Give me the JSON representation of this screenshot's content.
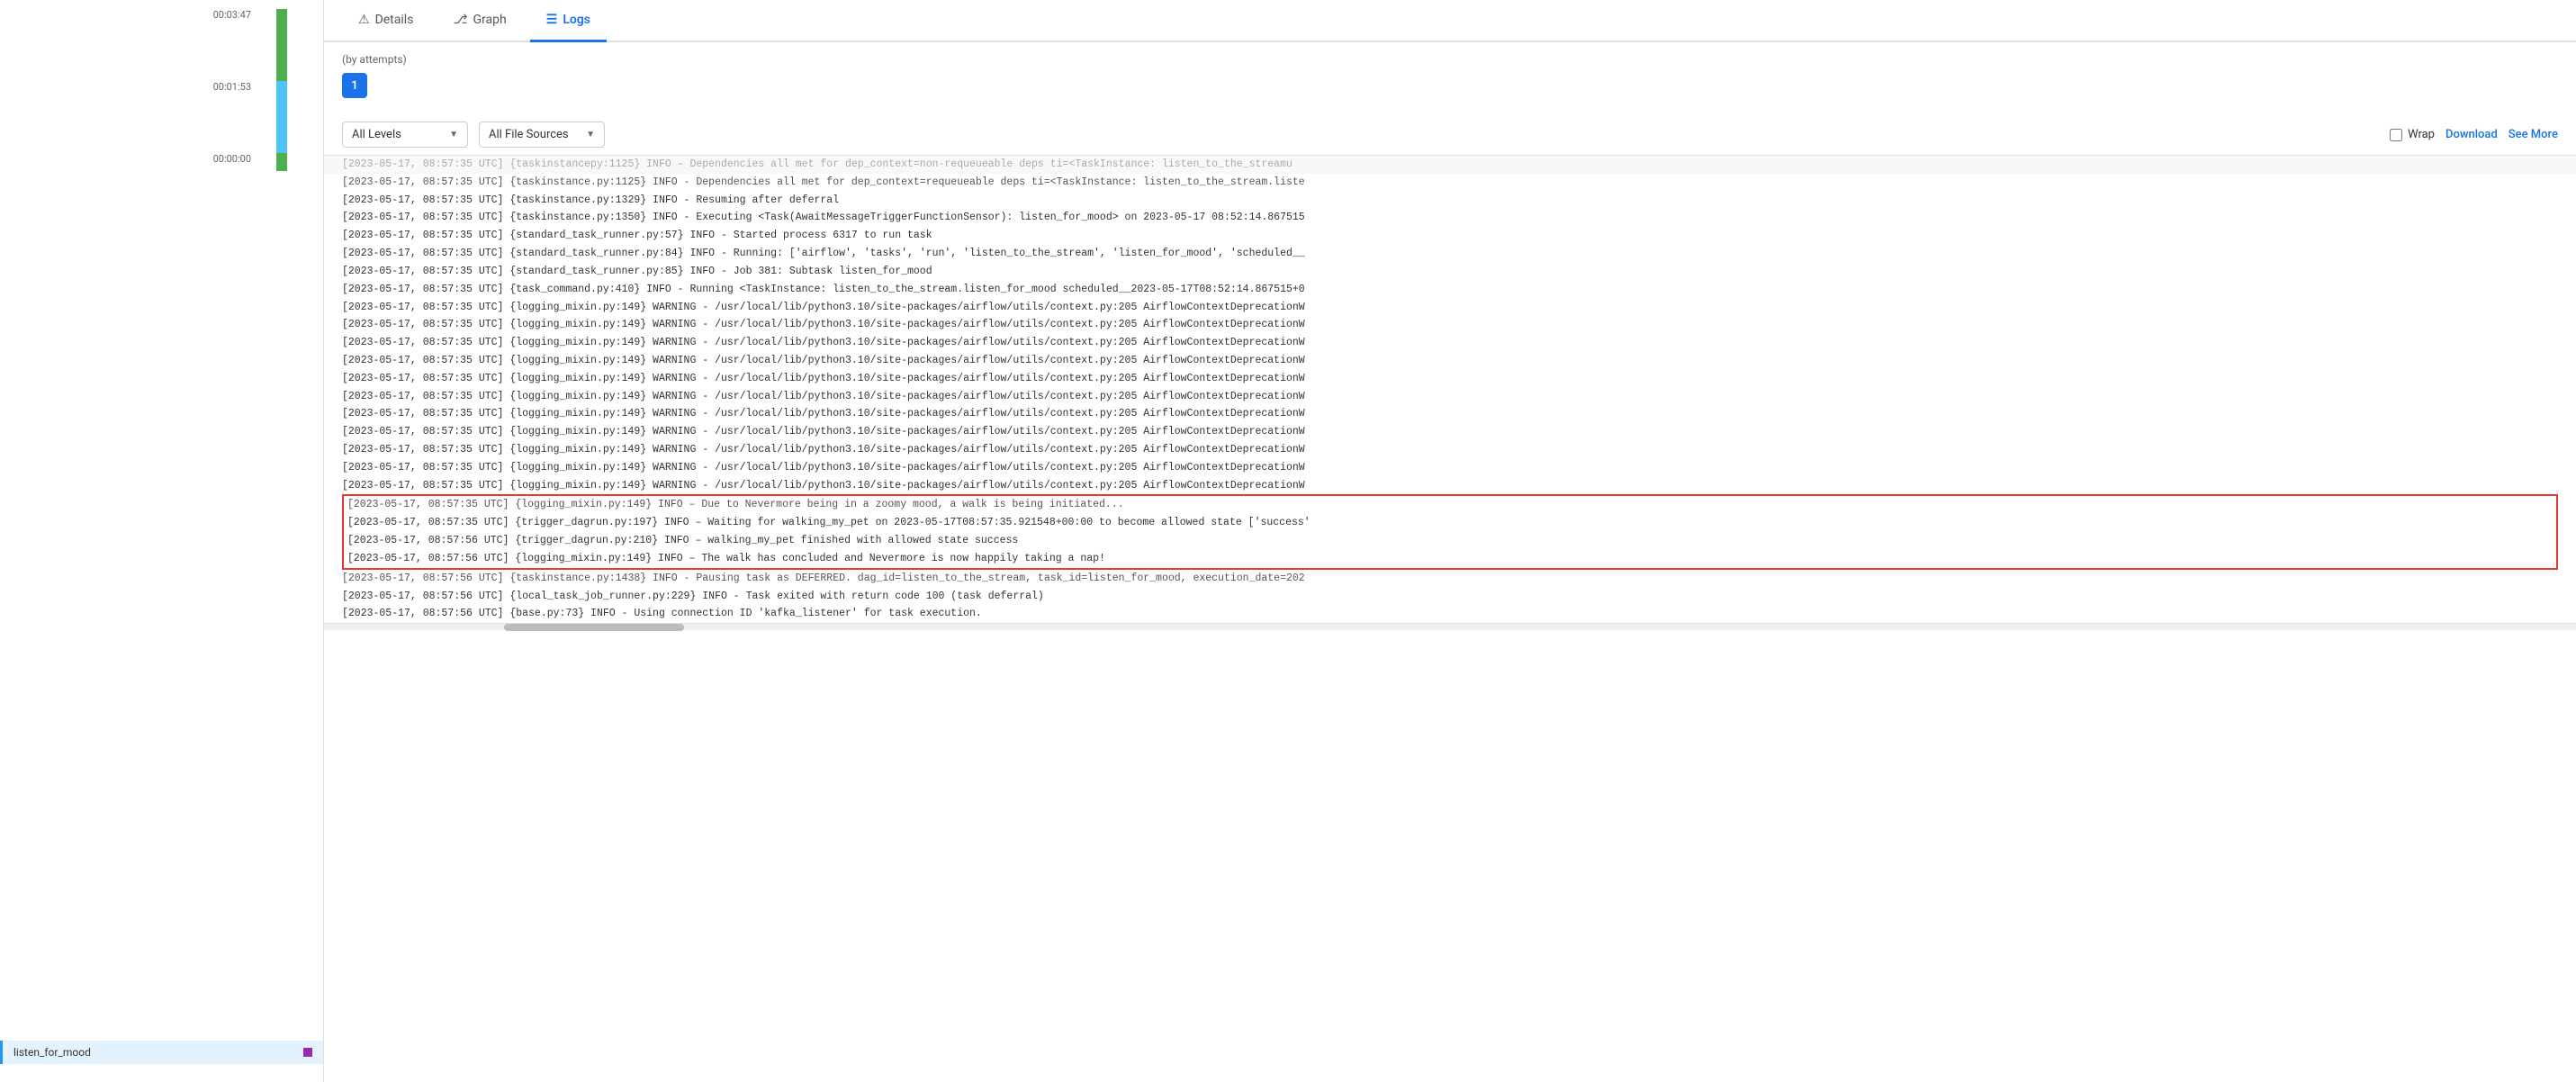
{
  "sidebar": {
    "time_labels": [
      "00:03:47",
      "00:01:53",
      "00:00:00"
    ],
    "task_name": "listen_for_mood"
  },
  "tabs": [
    {
      "id": "details",
      "label": "Details",
      "icon": "⚠",
      "active": false
    },
    {
      "id": "graph",
      "label": "Graph",
      "icon": "🔗",
      "active": false
    },
    {
      "id": "logs",
      "label": "Logs",
      "icon": "≡",
      "active": true
    }
  ],
  "logs": {
    "by_attempts_label": "(by attempts)",
    "attempt_number": "1",
    "controls": {
      "level_filter": "All Levels",
      "source_filter": "All File Sources",
      "wrap_label": "Wrap",
      "download_label": "Download",
      "see_more_label": "See More"
    },
    "lines": [
      "[2023-05-17, 08:57:35 UTC] {taskinstance.py:1125} INFO - Dependencies all met for dep_context=requeueable deps ti=<TaskInstance: listen_to_the_stream.liste",
      "[2023-05-17, 08:57:35 UTC] {taskinstance.py:1329} INFO - Resuming after deferral",
      "[2023-05-17, 08:57:35 UTC] {taskinstance.py:1350} INFO - Executing <Task(AwaitMessageTriggerFunctionSensor): listen_for_mood> on 2023-05-17 08:52:14.867515",
      "[2023-05-17, 08:57:35 UTC] {standard_task_runner.py:57} INFO - Started process 6317 to run task",
      "[2023-05-17, 08:57:35 UTC] {standard_task_runner.py:84} INFO - Running: ['airflow', 'tasks', 'run', 'listen_to_the_stream', 'listen_for_mood', 'scheduled__",
      "[2023-05-17, 08:57:35 UTC] {standard_task_runner.py:85} INFO - Job 381: Subtask listen_for_mood",
      "[2023-05-17, 08:57:35 UTC] {task_command.py:410} INFO - Running <TaskInstance: listen_to_the_stream.listen_for_mood scheduled__2023-05-17T08:52:14.867515+0",
      "[2023-05-17, 08:57:35 UTC] {logging_mixin.py:149} WARNING - /usr/local/lib/python3.10/site-packages/airflow/utils/context.py:205 AirflowContextDeprecationW",
      "[2023-05-17, 08:57:35 UTC] {logging_mixin.py:149} WARNING - /usr/local/lib/python3.10/site-packages/airflow/utils/context.py:205 AirflowContextDeprecationW",
      "[2023-05-17, 08:57:35 UTC] {logging_mixin.py:149} WARNING - /usr/local/lib/python3.10/site-packages/airflow/utils/context.py:205 AirflowContextDeprecationW",
      "[2023-05-17, 08:57:35 UTC] {logging_mixin.py:149} WARNING - /usr/local/lib/python3.10/site-packages/airflow/utils/context.py:205 AirflowContextDeprecationW",
      "[2023-05-17, 08:57:35 UTC] {logging_mixin.py:149} WARNING - /usr/local/lib/python3.10/site-packages/airflow/utils/context.py:205 AirflowContextDeprecationW",
      "[2023-05-17, 08:57:35 UTC] {logging_mixin.py:149} WARNING - /usr/local/lib/python3.10/site-packages/airflow/utils/context.py:205 AirflowContextDeprecationW",
      "[2023-05-17, 08:57:35 UTC] {logging_mixin.py:149} WARNING - /usr/local/lib/python3.10/site-packages/airflow/utils/context.py:205 AirflowContextDeprecationW",
      "[2023-05-17, 08:57:35 UTC] {logging_mixin.py:149} WARNING - /usr/local/lib/python3.10/site-packages/airflow/utils/context.py:205 AirflowContextDeprecationW",
      "[2023-05-17, 08:57:35 UTC] {logging_mixin.py:149} WARNING - /usr/local/lib/python3.10/site-packages/airflow/utils/context.py:205 AirflowContextDeprecationW",
      "[2023-05-17, 08:57:35 UTC] {logging_mixin.py:149} WARNING - /usr/local/lib/python3.10/site-packages/airflow/utils/context.py:205 AirflowContextDeprecationW",
      "[2023-05-17, 08:57:35 UTC] {logging_mixin.py:149} WARNING - /usr/local/lib/python3.10/site-packages/airflow/utils/context.py:205 AirflowContextDeprecationW"
    ],
    "highlighted_lines": [
      "[2023-05-17, 08:57:35 UTC] {logging_mixin.py:149} INFO – Due to Nevermore being in a zoomy mood, a walk is being initiated...",
      "[2023-05-17, 08:57:35 UTC] {trigger_dagrun.py:197} INFO – Waiting for walking_my_pet on 2023-05-17T08:57:35.921548+00:00 to become allowed state ['success'",
      "[2023-05-17, 08:57:56 UTC] {trigger_dagrun.py:210} INFO – walking_my_pet finished with allowed state success",
      "[2023-05-17, 08:57:56 UTC] {logging_mixin.py:149} INFO – The walk has concluded and Nevermore is now happily taking a nap!"
    ],
    "after_lines": [
      "[2023-05-17, 08:57:56 UTC] {taskinstance.py:1438} INFO - Pausing task as DEFERRED. dag_id=listen_to_the_stream, task_id=listen_for_mood, execution_date=202",
      "[2023-05-17, 08:57:56 UTC] {local_task_job_runner.py:229} INFO - Task exited with return code 100 (task deferral)",
      "[2023-05-17, 08:57:56 UTC] {base.py:73} INFO - Using connection ID 'kafka_listener' for task execution."
    ],
    "first_partial_line": "[2023-05-17, 08:57:35 UTC] {taskinstancepy:1125} INFO – Dependencies all met for dep_context=non-requeueable deps ti=<TaskInstance: listen_to_the_streamu"
  }
}
